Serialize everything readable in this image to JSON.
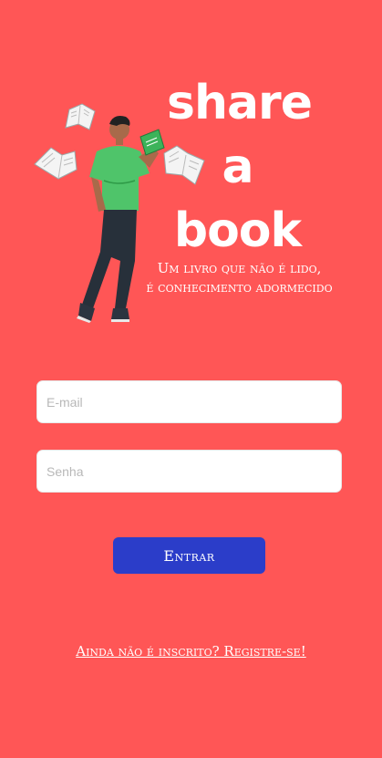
{
  "app": {
    "brand_line1": "share",
    "brand_line2": "a",
    "brand_line3": "book",
    "tagline_line1": "Um livro que não é lido,",
    "tagline_line2": "é conhecimento adormecido"
  },
  "login": {
    "email_placeholder": "E-mail",
    "email_value": "",
    "password_placeholder": "Senha",
    "password_value": "",
    "submit_label": "Entrar"
  },
  "footer": {
    "register_link": "Ainda não é inscrito? Registre-se!"
  },
  "icons": {
    "illustration": "reader-with-flying-books"
  },
  "colors": {
    "background": "#ff5656",
    "button": "#2b3dc9",
    "text": "#ffffff"
  }
}
